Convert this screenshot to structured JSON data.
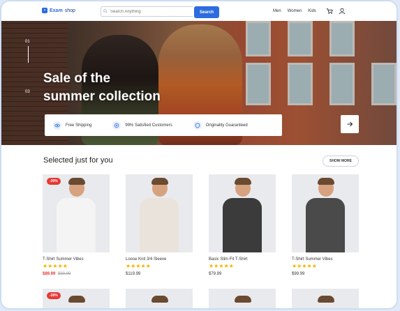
{
  "header": {
    "brand_main": "Exam",
    "brand_sub": "shop",
    "search_placeholder": "Search Anything",
    "search_button": "Search",
    "nav": [
      "Men",
      "Women",
      "Kids"
    ],
    "icons": [
      "search-icon",
      "cart-icon",
      "user-icon"
    ]
  },
  "hero": {
    "title_line1": "Sale of the",
    "title_line2": "summer collection",
    "slide_top": "01",
    "slide_bottom": "03",
    "features": [
      {
        "label": "Free Shipping",
        "icon": "eye-icon"
      },
      {
        "label": "99% Satisfied Customers",
        "icon": "badge-icon"
      },
      {
        "label": "Originality Guaranteed",
        "icon": "shield-icon"
      }
    ],
    "next_icon": "arrow-right-icon"
  },
  "section": {
    "title": "Selected just for you",
    "show_more": "SHOW MORE"
  },
  "products": [
    {
      "name": "T-Shirt Summer Vibes",
      "badge": "-30%",
      "price": "$89.99",
      "old_price": "$99.99",
      "stars": "★★★★★",
      "shirt": "#f4f4f4"
    },
    {
      "name": "Loose Knit 3/4 Sleeve",
      "badge": "",
      "price": "$119.99",
      "old_price": "",
      "stars": "★★★★★",
      "shirt": "#e9e3dc"
    },
    {
      "name": "Basic Slim Fit T-Shirt",
      "badge": "",
      "price": "$79.99",
      "old_price": "",
      "stars": "★★★★★",
      "shirt": "#3b3b3b"
    },
    {
      "name": "T-Shirt Summer Vibes",
      "badge": "",
      "price": "$99.99",
      "old_price": "",
      "stars": "★★★★★",
      "shirt": "#4a4a4a"
    }
  ],
  "second_row": [
    {
      "badge": "-30%"
    },
    {
      "badge": ""
    },
    {
      "badge": ""
    },
    {
      "badge": ""
    }
  ],
  "colors": {
    "accent": "#2d6cdf",
    "sale": "#e53935",
    "star": "#f1b400"
  }
}
